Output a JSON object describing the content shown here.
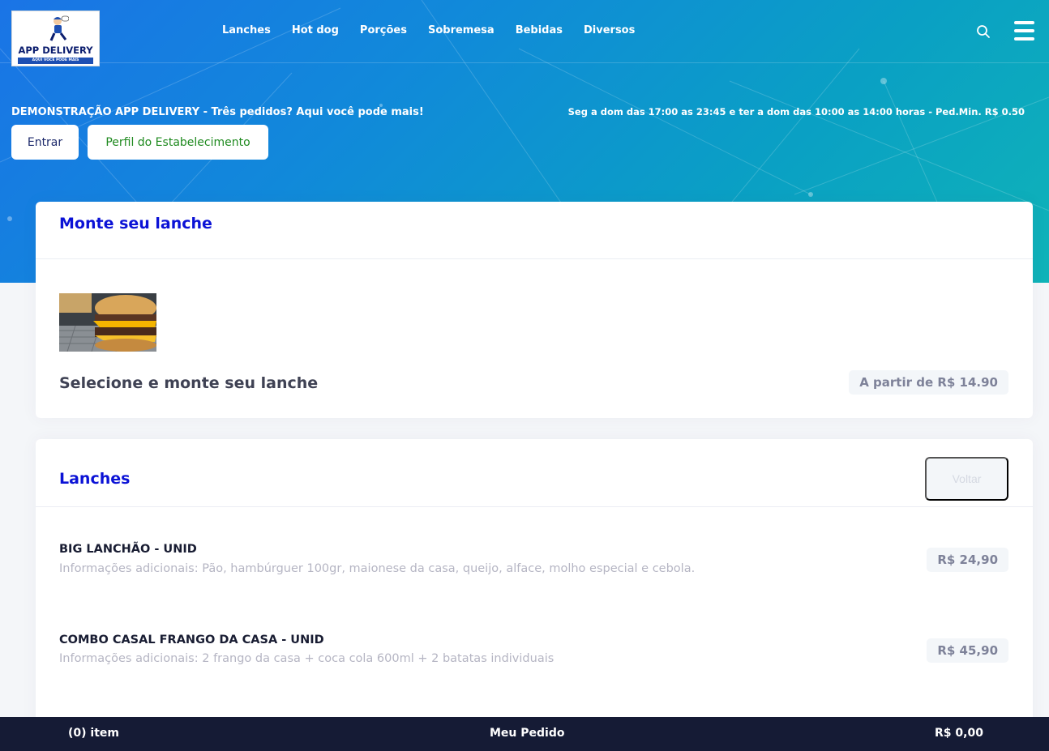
{
  "logo": {
    "brand": "APP DELIVERY",
    "tagline": "AQUI VOCÊ PODE MAIS"
  },
  "nav": {
    "items": [
      "Lanches",
      "Hot dog",
      "Porções",
      "Sobremesa",
      "Bebidas",
      "Diversos"
    ]
  },
  "icons": {
    "search": "search-icon",
    "menu": "hamburger-menu-icon"
  },
  "hero": {
    "store_title": "DEMONSTRAÇÃO APP DELIVERY - Três pedidos? Aqui você pode mais!",
    "hours": "Seg a dom das 17:00 as 23:45 e ter a dom das 10:00 as 14:00 horas - Ped.Min. R$ 0.50",
    "login_label": "Entrar",
    "profile_label": "Perfil do Estabelecimento"
  },
  "build_card": {
    "title": "Monte seu lanche",
    "item_name": "Selecione e monte seu lanche",
    "price": "A partir de R$ 14.90"
  },
  "lanches_card": {
    "title": "Lanches",
    "back_label": "Voltar",
    "products": [
      {
        "name": "BIG LANCHÃO - UNID",
        "description": "Informações adicionais: Pão, hambúrguer 100gr, maionese da casa, queijo, alface, molho especial e cebola.",
        "price": "R$ 24,90"
      },
      {
        "name": "COMBO CASAL FRANGO DA CASA - UNID",
        "description": "Informações adicionais: 2 frango da casa + coca cola 600ml + 2 batatas individuais",
        "price": "R$ 45,90"
      }
    ]
  },
  "footer": {
    "count": "(0) item",
    "label": "Meu Pedido",
    "total": "R$ 0,00"
  },
  "colors": {
    "title_blue": "#0b12d6",
    "footer_bg": "#151b35",
    "profile_green": "#1f8a1f"
  }
}
